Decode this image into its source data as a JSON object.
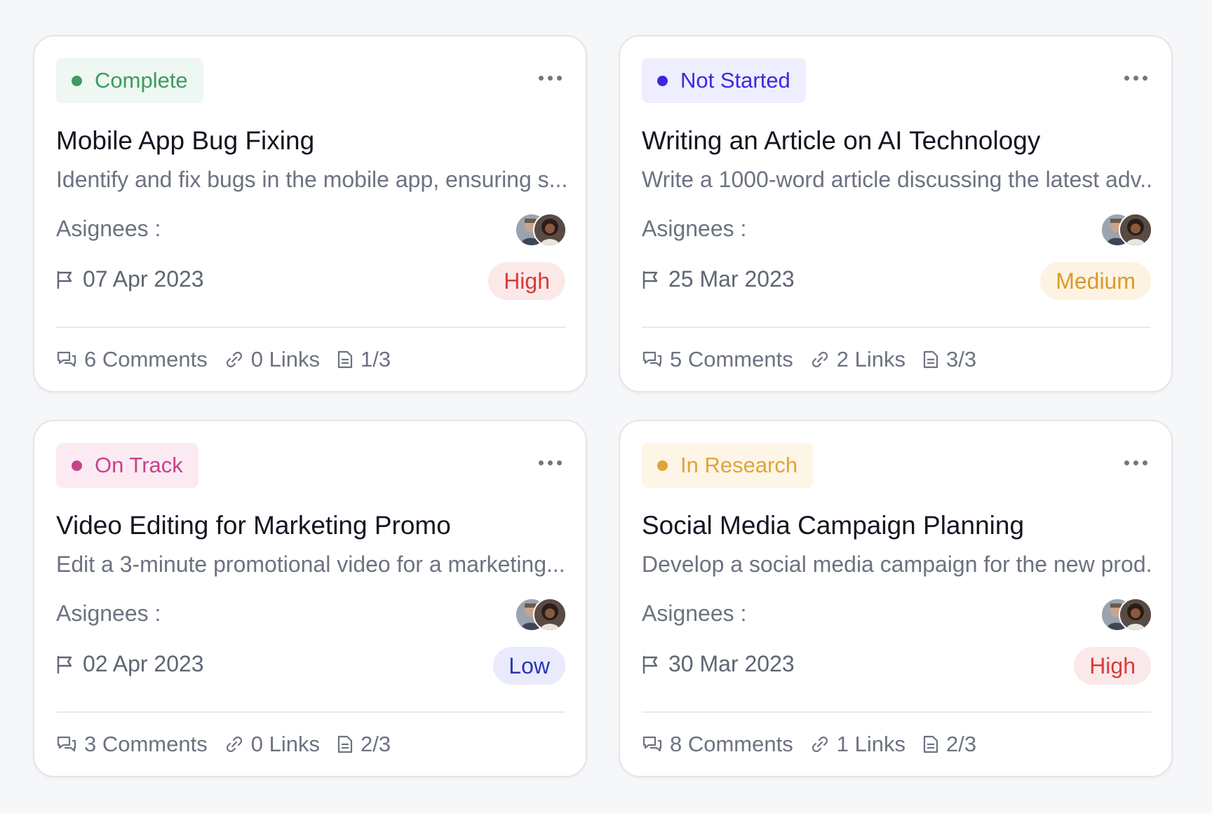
{
  "labels": {
    "assignees": "Asignees :"
  },
  "cards": [
    {
      "status": "Complete",
      "status_style": {
        "bg": "#eef7f1",
        "fg": "#3c9a62",
        "dot": "#3c9a62"
      },
      "title": "Mobile App Bug Fixing",
      "description": "Identify and fix bugs in the mobile app, ensuring s...",
      "due_date": "07 Apr 2023",
      "priority": "High",
      "priority_style": {
        "bg": "#fbe9e9",
        "fg": "#d93b3b"
      },
      "comments": "6 Comments",
      "links": "0 Links",
      "files": "1/3"
    },
    {
      "status": "Not Started",
      "status_style": {
        "bg": "#eeeefe",
        "fg": "#3f27e0",
        "dot": "#3f27e0"
      },
      "title": "Writing an Article on AI Technology",
      "description": "Write a 1000-word article discussing the latest adv...",
      "due_date": "25 Mar 2023",
      "priority": "Medium",
      "priority_style": {
        "bg": "#fdf3e2",
        "fg": "#d99a2b"
      },
      "comments": "5 Comments",
      "links": "2 Links",
      "files": "3/3"
    },
    {
      "status": "On Track",
      "status_style": {
        "bg": "#fceaf3",
        "fg": "#c7428c",
        "dot": "#c7428c"
      },
      "title": "Video Editing for Marketing Promo",
      "description": "Edit a 3-minute promotional video for a marketing...",
      "due_date": "02 Apr 2023",
      "priority": "Low",
      "priority_style": {
        "bg": "#e9ebfd",
        "fg": "#2c35b5"
      },
      "comments": "3 Comments",
      "links": "0 Links",
      "files": "2/3"
    },
    {
      "status": "In Research",
      "status_style": {
        "bg": "#fdf5e6",
        "fg": "#e0a43a",
        "dot": "#e0a43a"
      },
      "title": "Social Media Campaign Planning",
      "description": "Develop a social media campaign for the new prod...",
      "due_date": "30 Mar 2023",
      "priority": "High",
      "priority_style": {
        "bg": "#fbe9e9",
        "fg": "#d93b3b"
      },
      "comments": "8 Comments",
      "links": "1 Links",
      "files": "2/3"
    }
  ]
}
